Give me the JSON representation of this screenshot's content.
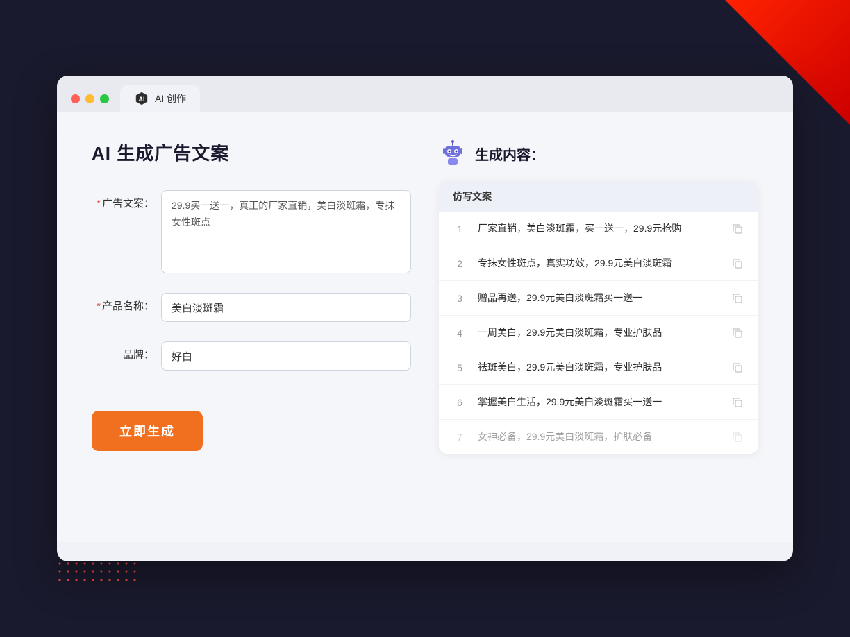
{
  "browser": {
    "tab_label": "AI 创作"
  },
  "page": {
    "title": "AI 生成广告文案",
    "generate_button": "立即生成"
  },
  "form": {
    "ad_copy_label": "广告文案：",
    "ad_copy_required": "*",
    "ad_copy_value": "29.9买一送一，真正的厂家直销，美白淡斑霜，专抹女性斑点",
    "product_label": "产品名称：",
    "product_required": "*",
    "product_value": "美白淡斑霜",
    "brand_label": "品牌：",
    "brand_value": "好白"
  },
  "results": {
    "header_title": "生成内容：",
    "column_label": "仿写文案",
    "items": [
      {
        "num": "1",
        "text": "厂家直销，美白淡斑霜，买一送一，29.9元抢购",
        "faded": false
      },
      {
        "num": "2",
        "text": "专抹女性斑点，真实功效，29.9元美白淡斑霜",
        "faded": false
      },
      {
        "num": "3",
        "text": "赠品再送，29.9元美白淡斑霜买一送一",
        "faded": false
      },
      {
        "num": "4",
        "text": "一周美白，29.9元美白淡斑霜，专业护肤品",
        "faded": false
      },
      {
        "num": "5",
        "text": "祛斑美白，29.9元美白淡斑霜，专业护肤品",
        "faded": false
      },
      {
        "num": "6",
        "text": "掌握美白生活，29.9元美白淡斑霜买一送一",
        "faded": false
      },
      {
        "num": "7",
        "text": "女神必备，29.9元美白淡斑霜，护肤必备",
        "faded": true
      }
    ]
  },
  "colors": {
    "accent_orange": "#f07020",
    "required_red": "#e74c3c",
    "bg": "#f5f6fa"
  }
}
